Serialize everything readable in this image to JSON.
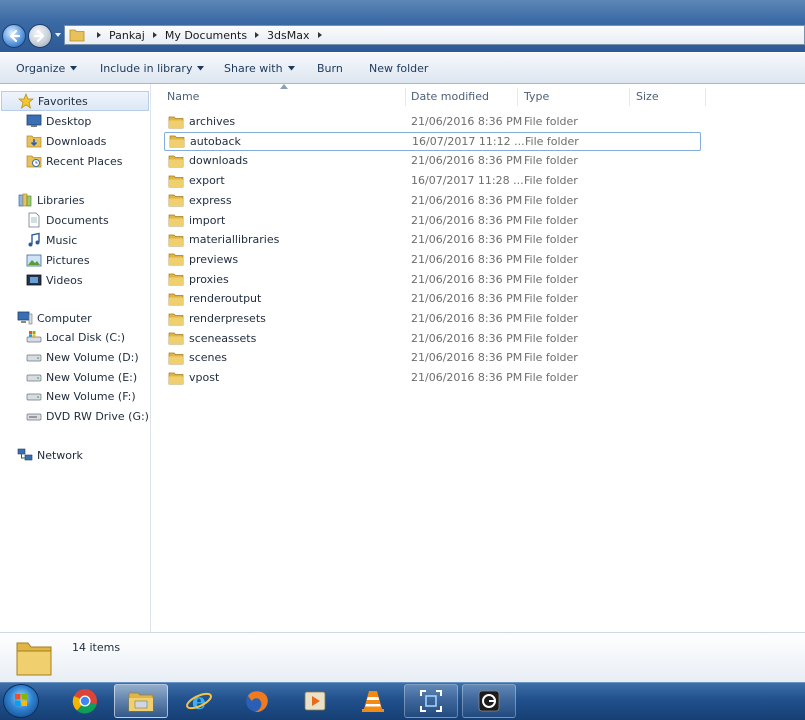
{
  "address": {
    "crumbs": [
      "Pankaj",
      "My Documents",
      "3dsMax"
    ]
  },
  "toolbar": {
    "organize": "Organize",
    "include_in_library": "Include in library",
    "share_with": "Share with",
    "burn": "Burn",
    "new_folder": "New folder"
  },
  "nav": {
    "favorites": {
      "label": "Favorites",
      "items": [
        "Desktop",
        "Downloads",
        "Recent Places"
      ]
    },
    "libraries": {
      "label": "Libraries",
      "items": [
        "Documents",
        "Music",
        "Pictures",
        "Videos"
      ]
    },
    "computer": {
      "label": "Computer",
      "items": [
        "Local Disk (C:)",
        "New Volume (D:)",
        "New Volume (E:)",
        "New Volume (F:)",
        "DVD RW Drive (G:) M"
      ]
    },
    "network": {
      "label": "Network"
    }
  },
  "columns": {
    "name": "Name",
    "date_modified": "Date modified",
    "type": "Type",
    "size": "Size"
  },
  "files": [
    {
      "name": "archives",
      "date": "21/06/2016 8:36 PM",
      "type": "File folder"
    },
    {
      "name": "autoback",
      "date": "16/07/2017 11:12 ...",
      "type": "File folder"
    },
    {
      "name": "downloads",
      "date": "21/06/2016 8:36 PM",
      "type": "File folder"
    },
    {
      "name": "export",
      "date": "16/07/2017 11:28 ...",
      "type": "File folder"
    },
    {
      "name": "express",
      "date": "21/06/2016 8:36 PM",
      "type": "File folder"
    },
    {
      "name": "import",
      "date": "21/06/2016 8:36 PM",
      "type": "File folder"
    },
    {
      "name": "materiallibraries",
      "date": "21/06/2016 8:36 PM",
      "type": "File folder"
    },
    {
      "name": "previews",
      "date": "21/06/2016 8:36 PM",
      "type": "File folder"
    },
    {
      "name": "proxies",
      "date": "21/06/2016 8:36 PM",
      "type": "File folder"
    },
    {
      "name": "renderoutput",
      "date": "21/06/2016 8:36 PM",
      "type": "File folder"
    },
    {
      "name": "renderpresets",
      "date": "21/06/2016 8:36 PM",
      "type": "File folder"
    },
    {
      "name": "sceneassets",
      "date": "21/06/2016 8:36 PM",
      "type": "File folder"
    },
    {
      "name": "scenes",
      "date": "21/06/2016 8:36 PM",
      "type": "File folder"
    },
    {
      "name": "vpost",
      "date": "21/06/2016 8:36 PM",
      "type": "File folder"
    }
  ],
  "details": {
    "item_count": "14 items"
  },
  "taskbar": {
    "icons": [
      "start-orb",
      "chrome-icon",
      "explorer-icon",
      "ie-icon",
      "firefox-icon",
      "media-player-icon",
      "vlc-icon",
      "capture-icon",
      "app-icon"
    ]
  },
  "colors": {
    "folder": "#e8c15a",
    "selection_border": "#84acdd",
    "taskbar": "#21508c"
  }
}
